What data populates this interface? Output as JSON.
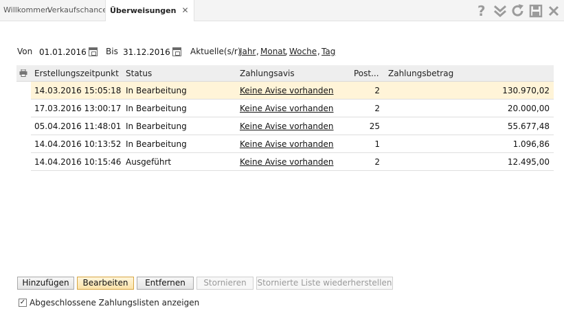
{
  "tabs": [
    {
      "label": "Willkommen"
    },
    {
      "label": "Verkaufschancen"
    },
    {
      "label": "Überweisungen",
      "active": true
    }
  ],
  "tab_close_glyph": "✕",
  "toolbar": [
    {
      "icon": "help-icon",
      "glyph": "?"
    },
    {
      "icon": "double-chevron-down-icon",
      "glyph": "»"
    },
    {
      "icon": "refresh-icon",
      "glyph": "↻"
    },
    {
      "icon": "save-icon",
      "glyph": "💾"
    },
    {
      "icon": "close-icon",
      "glyph": "✕"
    }
  ],
  "filter": {
    "from_label": "Von",
    "from_value": "01.01.2016",
    "to_label": "Bis",
    "to_value": "31.12.2016",
    "current_label": "Aktuelle(s/r)",
    "links": [
      "Jahr",
      "Monat",
      "Woche",
      "Tag"
    ],
    "separator": ","
  },
  "table": {
    "columns": [
      "Erstellungszeitpunkt",
      "Status",
      "Zahlungsavis",
      "Post...",
      "Zahlungsbetrag"
    ],
    "rows": [
      {
        "created": "14.03.2016 15:05:18",
        "status": "In Bearbeitung",
        "avis": "Keine Avise vorhanden",
        "posts": "2",
        "amount": "130.970,02",
        "selected": true
      },
      {
        "created": "17.03.2016 13:00:17",
        "status": "In Bearbeitung",
        "avis": "Keine Avise vorhanden",
        "posts": "2",
        "amount": "20.000,00"
      },
      {
        "created": "05.04.2016 11:48:01",
        "status": "In Bearbeitung",
        "avis": "Keine Avise vorhanden",
        "posts": "25",
        "amount": "55.677,48"
      },
      {
        "created": "14.04.2016 10:13:52",
        "status": "In Bearbeitung",
        "avis": "Keine Avise vorhanden",
        "posts": "1",
        "amount": "1.096,86"
      },
      {
        "created": "14.04.2016 10:15:46",
        "status": "Ausgeführt",
        "avis": "Keine Avise vorhanden",
        "posts": "2",
        "amount": "12.495,00"
      }
    ]
  },
  "buttons": {
    "add": "Hinzufügen",
    "edit": "Bearbeiten",
    "remove": "Entfernen",
    "cancel": "Stornieren",
    "restore": "Stornierte Liste wiederherstellen"
  },
  "show_closed": {
    "checked": true,
    "check_glyph": "✓",
    "label": "Abgeschlossene Zahlungslisten anzeigen"
  },
  "colors": {
    "selected_row": "#fff4d8",
    "primary_button_border": "#d6a541",
    "toolbar_icon": "#9b9b9b"
  }
}
